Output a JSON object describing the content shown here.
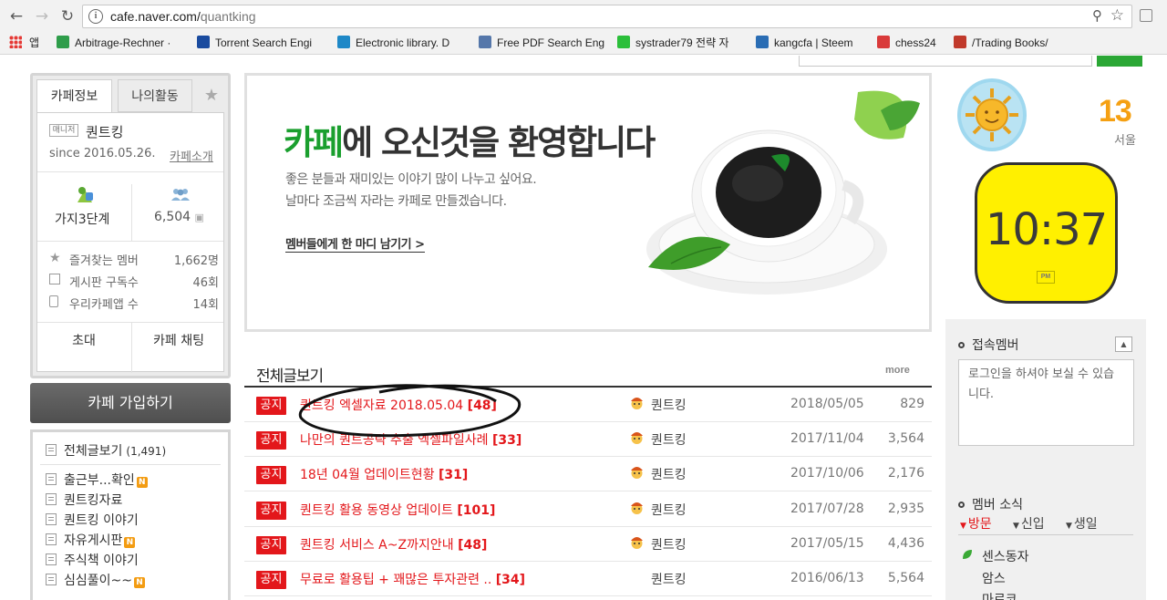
{
  "browser": {
    "url_host": "cafe.naver.com/",
    "url_path": "quantking",
    "bookmarks": [
      {
        "label": "앱",
        "icon": "apps-grid-icon",
        "color": "#e53935"
      },
      {
        "label": "Arbitrage-Rechner ·",
        "icon": "sheet-icon",
        "color": "#2e9d4a"
      },
      {
        "label": "Torrent Search Engi",
        "icon": "t-logo-icon",
        "color": "#1a4b9f"
      },
      {
        "label": "Electronic library. D",
        "icon": "globe-icon",
        "color": "#1e88c7"
      },
      {
        "label": "Free PDF Search Eng",
        "icon": "doc-icon",
        "color": "#5577aa"
      },
      {
        "label": "systrader79 전략 자",
        "icon": "chat-icon",
        "color": "#2bbf3a"
      },
      {
        "label": "kangcfa | Steem",
        "icon": "wordpress-icon",
        "color": "#2a6db4"
      },
      {
        "label": "chess24",
        "icon": "chess-icon",
        "color": "#d93a3a"
      },
      {
        "label": "/Trading Books/",
        "icon": "gear-icon",
        "color": "#c0392b"
      }
    ]
  },
  "left": {
    "tab_info": "카페정보",
    "tab_activity": "나의활동",
    "manager_badge": "매니저",
    "cafe_name": "퀀트킹",
    "since": "since 2016.05.26.",
    "intro_link": "카페소개",
    "level_label": "가지3단계",
    "member_count": "6,504",
    "stats": [
      {
        "label": "즐겨찾는 멤버",
        "value": "1,662명"
      },
      {
        "label": "게시판 구독수",
        "value": "46회"
      },
      {
        "label": "우리카페앱 수",
        "value": "14회"
      }
    ],
    "invite": "초대",
    "chat": "카페 채팅",
    "join": "카페 가입하기",
    "menu": [
      {
        "label": "전체글보기",
        "count": "(1,491)"
      },
      {
        "label": "출근부...확인",
        "new": "N"
      },
      {
        "label": "퀀트킹자료"
      },
      {
        "label": "퀀트킹 이야기"
      },
      {
        "label": "자유게시판",
        "new": "N"
      },
      {
        "label": "주식책 이야기"
      },
      {
        "label": "심심풀이~~",
        "new": "N"
      }
    ]
  },
  "banner": {
    "title_green": "카페",
    "title_rest": "에 오신것을 환영합니다",
    "sub1": "좋은 분들과 재미있는 이야기 많이 나누고 싶어요.",
    "sub2": "날마다 조금씩 자라는 카페로 만들겠습니다.",
    "link": "멤버들에게 한 마디 남기기 >"
  },
  "articles": {
    "heading": "전체글보기",
    "more": "more",
    "badge": "공지",
    "rows": [
      {
        "title": "퀀트킹 엑셀자료 2018.05.04 ",
        "count": "[48]",
        "author": "퀀트킹",
        "date": "2018/05/05",
        "views": "829"
      },
      {
        "title": "나만의 퀀트공략 추출 엑셀파일사례 ",
        "count": "[33]",
        "author": "퀀트킹",
        "date": "2017/11/04",
        "views": "3,564"
      },
      {
        "title": "18년 04월 업데이트현황 ",
        "count": "[31]",
        "author": "퀀트킹",
        "date": "2017/10/06",
        "views": "2,176"
      },
      {
        "title": "퀀트킹 활용 동영상 업데이트 ",
        "count": "[101]",
        "author": "퀀트킹",
        "date": "2017/07/28",
        "views": "2,935"
      },
      {
        "title": "퀀트킹 서비스 A~Z까지안내 ",
        "count": "[48]",
        "author": "퀀트킹",
        "date": "2017/05/15",
        "views": "4,436"
      },
      {
        "title": "무료로 활용팁 + 꽤많은 투자관련 .. ",
        "count": "[34]",
        "author": "퀀트킹",
        "date": "2016/06/13",
        "views": "5,564"
      }
    ]
  },
  "right": {
    "temperature": "13",
    "city": "서울",
    "clock_time": "10:37",
    "clock_period": "PM",
    "online_title": "접속멤버",
    "login_msg": "로그인을 하셔야 보실 수 있습니다.",
    "news_title": "멤버 소식",
    "news_tabs": [
      "방문",
      "신입",
      "생일"
    ],
    "news_items": [
      "센스동자",
      "암스",
      "마르코"
    ]
  }
}
